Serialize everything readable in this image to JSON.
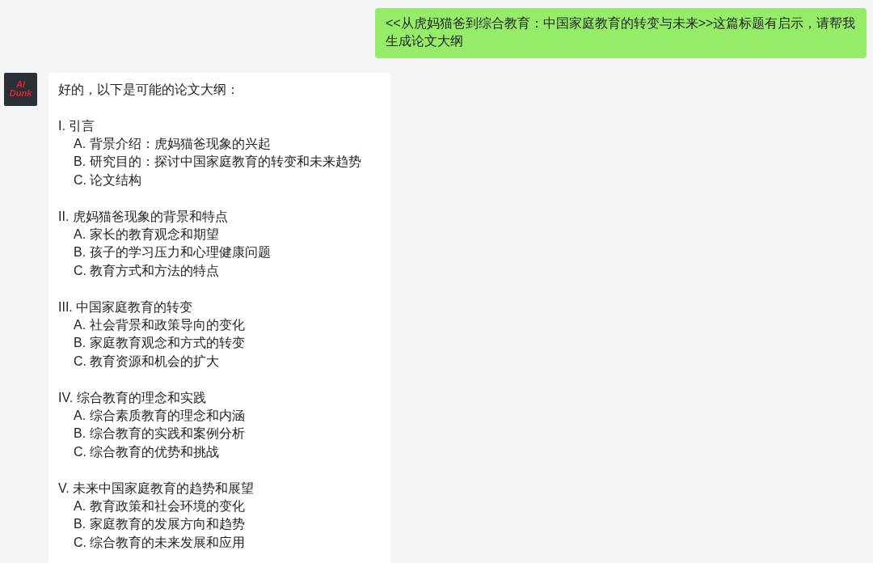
{
  "messages": [
    {
      "kind": "user",
      "text": "<<从虎妈猫爸到综合教育：中国家庭教育的转变与未来>>这篇标题有启示，请帮我生成论文大纲"
    },
    {
      "kind": "bot",
      "avatar": {
        "lines": [
          "AI",
          "Dunk"
        ]
      },
      "intro": "好的，以下是可能的论文大纲：",
      "sections": [
        {
          "heading": "I. 引言",
          "items": [
            "A. 背景介绍：虎妈猫爸现象的兴起",
            "B. 研究目的：探讨中国家庭教育的转变和未来趋势",
            "C. 论文结构"
          ]
        },
        {
          "heading": "II. 虎妈猫爸现象的背景和特点",
          "items": [
            "A. 家长的教育观念和期望",
            "B. 孩子的学习压力和心理健康问题",
            "C. 教育方式和方法的特点"
          ]
        },
        {
          "heading": "III. 中国家庭教育的转变",
          "items": [
            "A. 社会背景和政策导向的变化",
            "B. 家庭教育观念和方式的转变",
            "C. 教育资源和机会的扩大"
          ]
        },
        {
          "heading": "IV. 综合教育的理念和实践",
          "items": [
            "A. 综合素质教育的理念和内涵",
            "B. 综合教育的实践和案例分析",
            "C. 综合教育的优势和挑战"
          ]
        },
        {
          "heading": "V. 未来中国家庭教育的趋势和展望",
          "items": [
            "A. 教育政策和社会环境的变化",
            "B. 家庭教育的发展方向和趋势",
            "C. 综合教育的未来发展和应用"
          ]
        }
      ]
    }
  ]
}
